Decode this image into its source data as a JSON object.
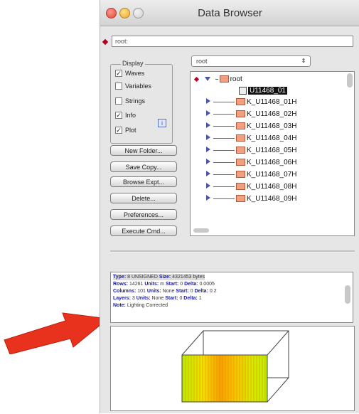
{
  "window": {
    "title": "Data Browser"
  },
  "path": {
    "value": "root:"
  },
  "display": {
    "label": "Display",
    "items": [
      {
        "label": "Waves",
        "checked": true
      },
      {
        "label": "Variables",
        "checked": false
      },
      {
        "label": "Strings",
        "checked": false
      },
      {
        "label": "Info",
        "checked": true
      },
      {
        "label": "Plot",
        "checked": true
      }
    ],
    "info_button": "i"
  },
  "buttons": {
    "new_folder": "New Folder...",
    "save_copy": "Save Copy...",
    "browse_expt": "Browse Expt...",
    "delete": "Delete...",
    "preferences": "Preferences...",
    "execute_cmd": "Execute Cmd..."
  },
  "folder_select": {
    "value": "root",
    "arrows": "⇕"
  },
  "tree": {
    "root_label": "root",
    "selected_wave": "U11468_01",
    "folders": [
      "K_U11468_01H",
      "K_U11468_02H",
      "K_U11468_03H",
      "K_U11468_04H",
      "K_U11468_05H",
      "K_U11468_06H",
      "K_U11468_07H",
      "K_U11468_08H",
      "K_U11468_09H"
    ]
  },
  "info": {
    "line1_k1": "Type:",
    "line1_v1": "8 UNSIGNED",
    "line1_k2": "Size:",
    "line1_v2": "4321453 bytes",
    "line2_k1": "Rows:",
    "line2_v1": "14261",
    "line2_k2": "Units:",
    "line2_v2": "m",
    "line2_k3": "Start:",
    "line2_v3": "0",
    "line2_k4": "Delta:",
    "line2_v4": "0.0005",
    "line3_k1": "Columns:",
    "line3_v1": "101",
    "line3_k2": "Units:",
    "line3_v2": "None",
    "line3_k3": "Start:",
    "line3_v3": "0",
    "line3_k4": "Delta:",
    "line3_v4": "0.2",
    "line4_k1": "Layers:",
    "line4_v1": "3",
    "line4_k2": "Units:",
    "line4_v2": "None",
    "line4_k3": "Start:",
    "line4_v3": "0",
    "line4_k4": "Delta:",
    "line4_v4": "1",
    "line5_k1": "Note:",
    "line5_v1": "Lighting Corrected"
  },
  "colors": {
    "accent_diamond": "#b0001e",
    "arrow": "#e8321e",
    "info_key": "#1a1aa8"
  }
}
